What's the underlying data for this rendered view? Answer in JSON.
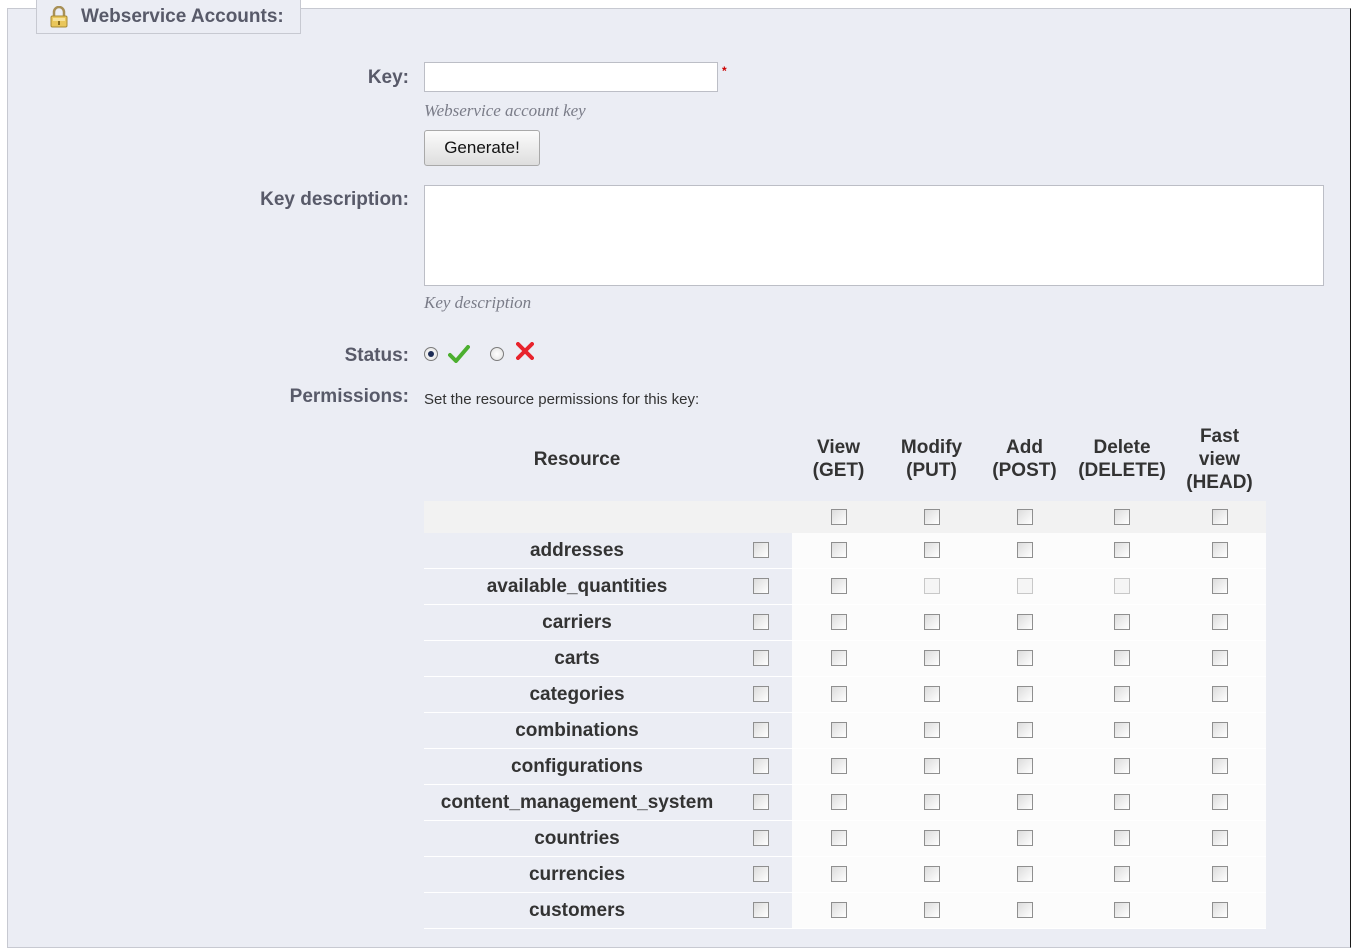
{
  "legend": {
    "title": "Webservice Accounts:",
    "icon": "lock-icon"
  },
  "key": {
    "label": "Key:",
    "value": "",
    "required_mark": "*",
    "hint": "Webservice account key",
    "generate_label": "Generate!"
  },
  "key_description": {
    "label": "Key description:",
    "value": "",
    "hint": "Key description"
  },
  "status": {
    "label": "Status:",
    "enabled_icon": "check-icon",
    "disabled_icon": "cross-icon",
    "selected": "enabled",
    "colors": {
      "enabled": "#4caf2f",
      "disabled": "#e8232c"
    }
  },
  "permissions": {
    "label": "Permissions:",
    "hint": "Set the resource permissions for this key:",
    "columns": {
      "resource": "Resource",
      "view": "View\n(GET)",
      "modify": "Modify\n(PUT)",
      "add": "Add\n(POST)",
      "delete": "Delete\n(DELETE)",
      "head": "Fast\nview\n(HEAD)"
    },
    "resources": [
      {
        "name": "addresses",
        "disabled": []
      },
      {
        "name": "available_quantities",
        "disabled": [
          1,
          2,
          3
        ]
      },
      {
        "name": "carriers",
        "disabled": []
      },
      {
        "name": "carts",
        "disabled": []
      },
      {
        "name": "categories",
        "disabled": []
      },
      {
        "name": "combinations",
        "disabled": []
      },
      {
        "name": "configurations",
        "disabled": []
      },
      {
        "name": "content_management_system",
        "disabled": []
      },
      {
        "name": "countries",
        "disabled": []
      },
      {
        "name": "currencies",
        "disabled": []
      },
      {
        "name": "customers",
        "disabled": []
      }
    ]
  }
}
